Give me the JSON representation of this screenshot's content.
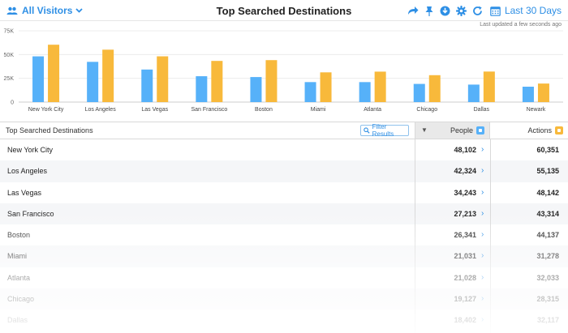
{
  "header": {
    "segment_label": "All Visitors",
    "title": "Top Searched Destinations",
    "date_range_label": "Last 30 Days"
  },
  "last_updated": "Last updated a few seconds ago",
  "table": {
    "dimension_header": "Top Searched Destinations",
    "filter_label": "Filter Results",
    "people_header": "People",
    "actions_header": "Actions",
    "rows": [
      {
        "name": "New York City",
        "people": "48,102",
        "actions": "60,351"
      },
      {
        "name": "Los Angeles",
        "people": "42,324",
        "actions": "55,135"
      },
      {
        "name": "Las Vegas",
        "people": "34,243",
        "actions": "48,142"
      },
      {
        "name": "San Francisco",
        "people": "27,213",
        "actions": "43,314"
      },
      {
        "name": "Boston",
        "people": "26,341",
        "actions": "44,137"
      },
      {
        "name": "Miami",
        "people": "21,031",
        "actions": "31,278"
      },
      {
        "name": "Atlanta",
        "people": "21,028",
        "actions": "32,033"
      },
      {
        "name": "Chicago",
        "people": "19,127",
        "actions": "28,315"
      },
      {
        "name": "Dallas",
        "people": "18,402",
        "actions": "32,117"
      }
    ]
  },
  "colors": {
    "people": "#56b1f9",
    "actions": "#f8b93b",
    "accent": "#2e8fe5"
  },
  "icons": {
    "segment": "users-icon",
    "share": "share-icon",
    "pin": "pin-icon",
    "download": "download-icon",
    "settings": "gear-icon",
    "refresh": "refresh-icon",
    "calendar": "calendar-icon",
    "filter": "search-icon",
    "drill": "chevron-right-icon"
  },
  "chart_data": {
    "type": "bar",
    "categories": [
      "New York City",
      "Los Angeles",
      "Las Vegas",
      "San Francisco",
      "Boston",
      "Miami",
      "Atlanta",
      "Chicago",
      "Dallas",
      "Newark"
    ],
    "series": [
      {
        "name": "People",
        "values": [
          48102,
          42324,
          34243,
          27213,
          26341,
          21031,
          21028,
          19127,
          18402,
          16200
        ]
      },
      {
        "name": "Actions",
        "values": [
          60351,
          55135,
          48142,
          43314,
          44137,
          31278,
          32033,
          28315,
          32117,
          19500
        ]
      }
    ],
    "yticks": [
      "0",
      "25K",
      "50K",
      "75K"
    ],
    "ylim": [
      0,
      75000
    ],
    "grid": true
  }
}
